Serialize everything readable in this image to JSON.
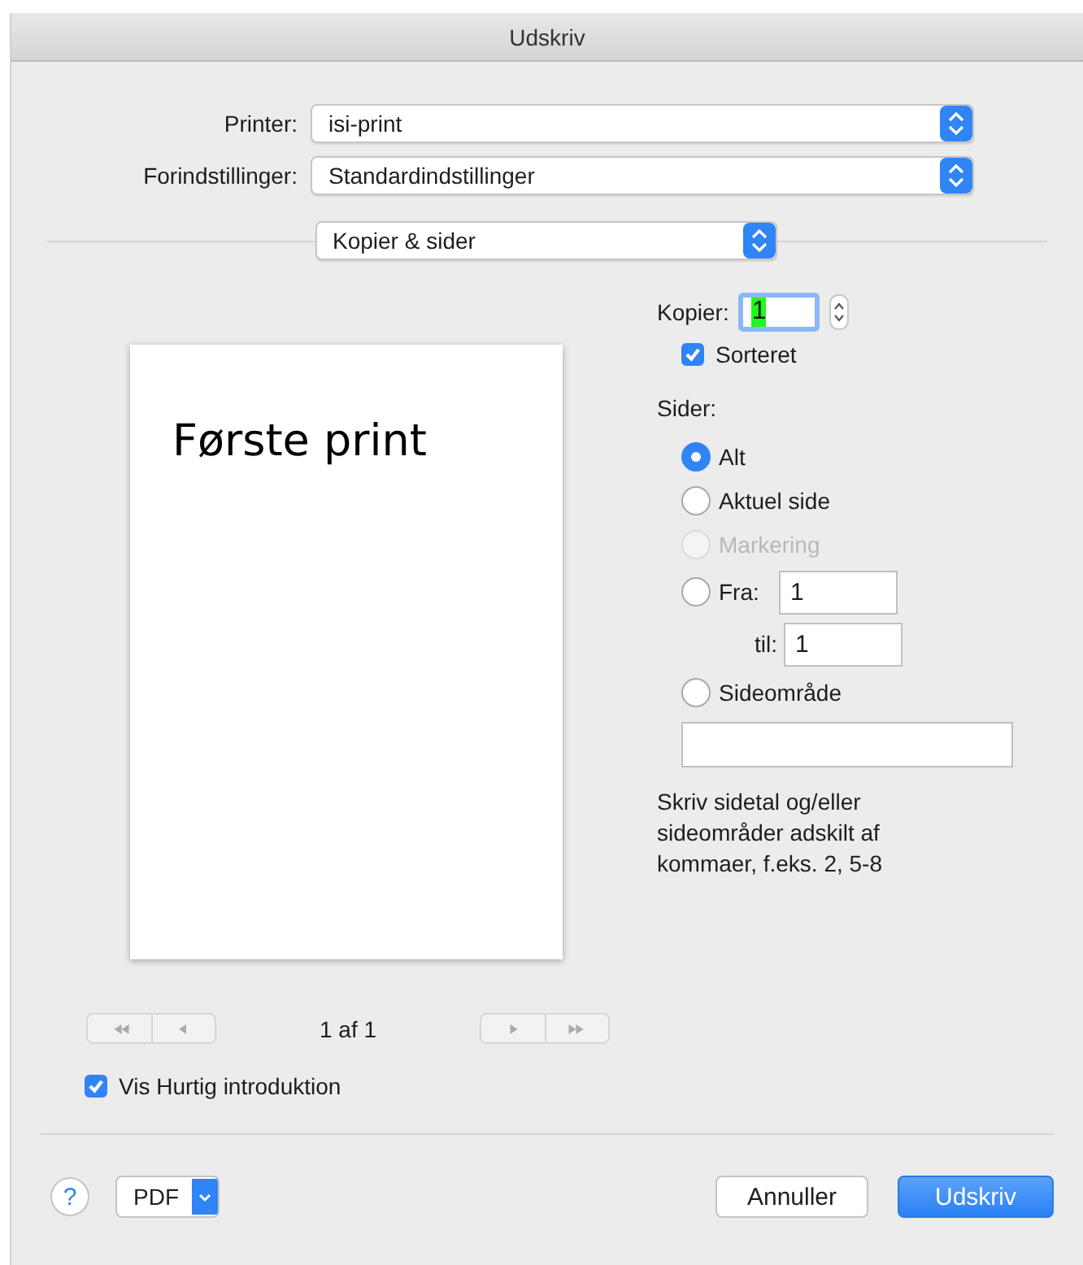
{
  "window": {
    "title": "Udskriv"
  },
  "printer": {
    "label": "Printer:",
    "value": "isi-print"
  },
  "presets": {
    "label": "Forindstillinger:",
    "value": "Standardindstillinger"
  },
  "section_menu": {
    "value": "Kopier & sider"
  },
  "preview": {
    "text": "Første print",
    "page_indicator": "1 af 1"
  },
  "nav_buttons": [
    {
      "kind": "first",
      "disabled": true
    },
    {
      "kind": "prev",
      "disabled": true
    },
    {
      "kind": "next",
      "disabled": true
    },
    {
      "kind": "last",
      "disabled": true
    }
  ],
  "copies": {
    "label": "Kopier:",
    "value": "1"
  },
  "collated": {
    "label": "Sorteret",
    "checked": true
  },
  "pages": {
    "label": "Sider:",
    "options": [
      {
        "kind": "plain",
        "label": "Alt",
        "selected": true,
        "disabled": false
      },
      {
        "kind": "plain",
        "label": "Aktuel side",
        "selected": false,
        "disabled": false
      },
      {
        "kind": "plain",
        "label": "Markering",
        "selected": false,
        "disabled": true
      },
      {
        "kind": "from_to",
        "label": "Fra:",
        "value": "1",
        "to_label": "til:",
        "to_value": "1",
        "selected": false,
        "disabled": false
      },
      {
        "kind": "range",
        "label": "Sideområde",
        "selected": false,
        "disabled": false
      }
    ],
    "hint": "Skriv sidetal og/eller sideområder adskilt af kommaer, f.eks. 2, 5-8"
  },
  "quick_intro": {
    "label": "Vis Hurtig introduktion",
    "checked": true
  },
  "help_button": {
    "label": "?"
  },
  "pdf_button": {
    "label": "PDF"
  },
  "buttons": [
    {
      "kind": "secondary",
      "label": "Annuller"
    },
    {
      "kind": "primary",
      "label": "Udskriv"
    }
  ]
}
